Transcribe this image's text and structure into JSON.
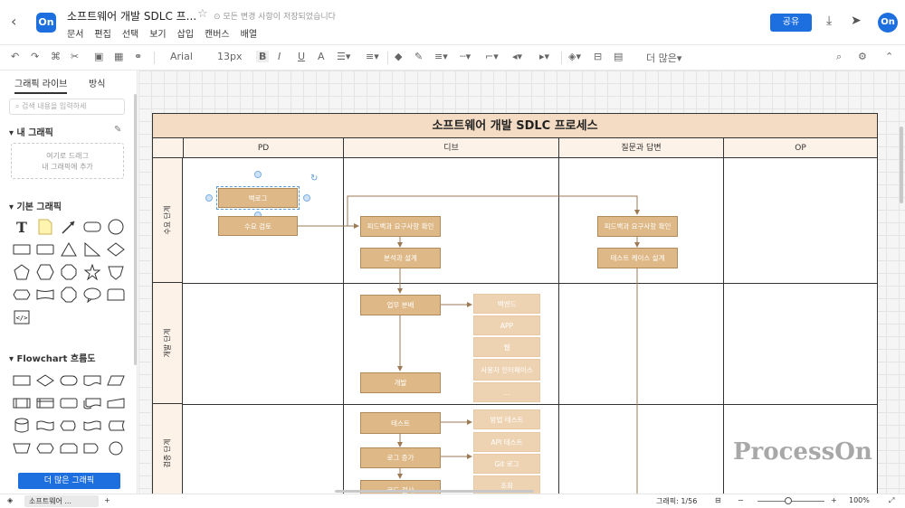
{
  "titlebar": {
    "doc_title": "소프트웨어 개발 SDLC 프...",
    "save_status": "⊙ 모든 변경 사항이 저장되었습니다",
    "menu": [
      "문서",
      "편집",
      "선택",
      "보기",
      "삽입",
      "캔버스",
      "배열"
    ],
    "share_label": "공유",
    "logo_text": "On",
    "avatar_text": "On",
    "icons": {
      "back": "‹",
      "star": "☆",
      "download": "⤓",
      "send": "➤"
    }
  },
  "toolbar": {
    "font_family": "Arial",
    "font_size": "13px",
    "bold": "B",
    "italic": "I",
    "underline": "U",
    "font_color": "A",
    "more_label": "더 많은"
  },
  "leftpanel": {
    "tabs": [
      "그래픽 라이브",
      "방식"
    ],
    "search_placeholder": "검색 내용을 입력하세",
    "my_graphics": "내 그래픽",
    "drop_hint_line1": "여기로 드래그",
    "drop_hint_line2": "내 그래픽에 추가",
    "basic_graphics": "기본 그래픽",
    "flowchart": "Flowchart 흐름도",
    "more_graphics": "더 많은 그래픽"
  },
  "diagram": {
    "title": "소프트웨어 개발 SDLC 프로세스",
    "columns": [
      "PD",
      "디브",
      "질문과 답변",
      "OP"
    ],
    "rows": [
      "수요 단계",
      "개발 단계",
      "검증 단계"
    ],
    "nodes": {
      "backlog": "백로그",
      "req_review": "수요 검토",
      "feedback_dev": "피드백과 요구사항 확인",
      "analysis_design": "분석과 설계",
      "task_split": "업무 분배",
      "development": "개발",
      "testing": "테스트",
      "log_increase": "로그 증가",
      "code_check": "코드 검사",
      "feedback_qa": "피드백과 요구사항 확인",
      "test_case_design": "테스트 케이스 설계",
      "backend": "백엔드",
      "app": "APP",
      "web": "웹",
      "ui": "사용자 인터페이스",
      "ellipsis": "...",
      "unit_test": "방법 테스트",
      "api_test": "API 테스트",
      "git_log": "Git 로그",
      "query": "조회"
    }
  },
  "watermark": "ProcessOn",
  "statusbar": {
    "page_tab": "소프트웨어 ...",
    "add": "+",
    "graphics_count": "그래픽: 1/56",
    "zoom_minus": "−",
    "zoom_plus": "+",
    "zoom": "100%"
  },
  "colors": {
    "accent": "#1d6fe0",
    "node_fill": "#deb887",
    "node_light": "#eed3b3",
    "header_fill": "#f3dcc3",
    "arrow": "#9b7a55"
  }
}
